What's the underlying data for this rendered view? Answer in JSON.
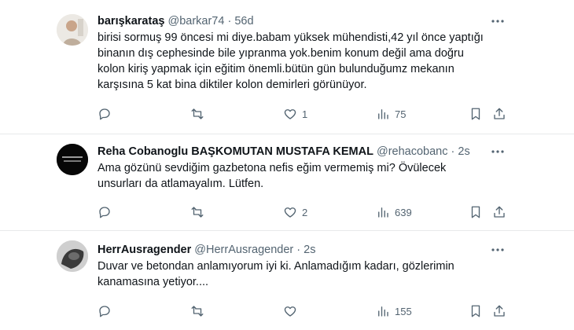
{
  "tweets": [
    {
      "name": "barışkarataş",
      "handle": "@barkar74",
      "sep": "·",
      "time": "56d",
      "text": "birisi sormuş 99 öncesi mi diye.babam yüksek mühendisti,42 yıl önce yaptığı binanın dış cephesinde bile yıpranma yok.benim konum değil ama doğru kolon kiriş yapmak için eğitim önemli.bütün gün bulunduğumz mekanın karşısına 5 kat bina diktiler kolon demirleri görünüyor.",
      "likes": "1",
      "views": "75"
    },
    {
      "name": "Reha Cobanoglu BAŞKOMUTAN MUSTAFA KEMAL",
      "handle": "@rehacobanc",
      "sep": "·",
      "time": "2s",
      "text": "Ama gözünü sevdiğim gazbetona nefis eğim vermemiş mi? Övülecek unsurları da atlamayalım. Lütfen.",
      "likes": "2",
      "views": "639"
    },
    {
      "name": "HerrAusragender",
      "handle": "@HerrAusragender",
      "sep": "·",
      "time": "2s",
      "text": "Duvar ve betondan anlamıyorum iyi ki. Anlamadığım kadarı, gözlerimin kanamasına yetiyor....",
      "likes": "",
      "views": "155"
    }
  ],
  "icons": {
    "reply": "reply-icon",
    "retweet": "retweet-icon",
    "like": "heart-icon",
    "views": "views-icon",
    "bookmark": "bookmark-icon",
    "share": "share-icon",
    "more": "more-icon"
  },
  "colors": {
    "text": "#0f1419",
    "secondary": "#536471",
    "divider": "#e7e9ea"
  }
}
